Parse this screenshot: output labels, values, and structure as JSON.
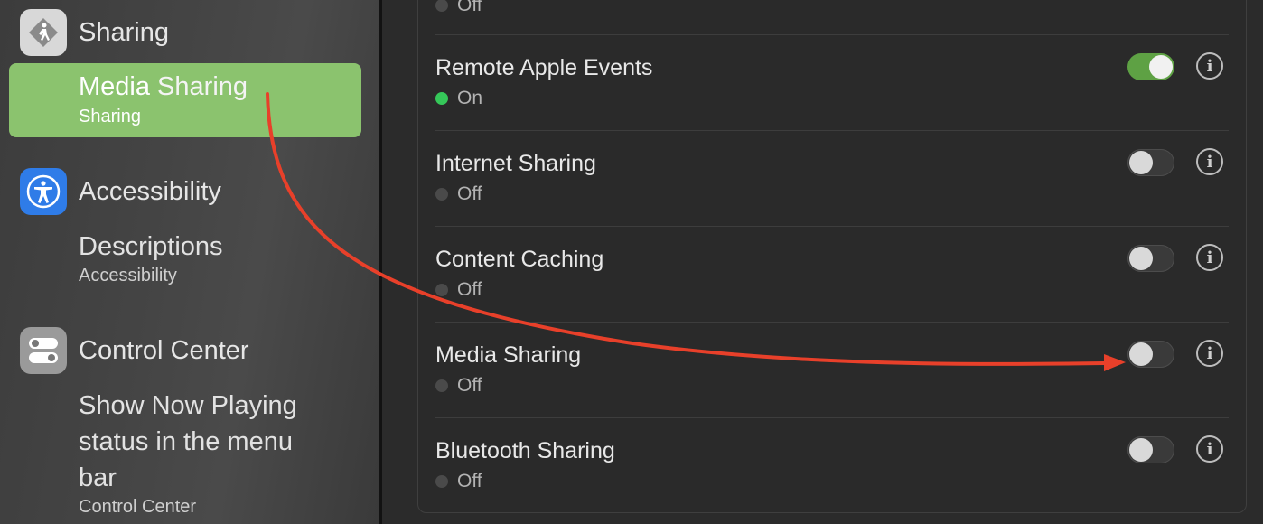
{
  "sidebar": {
    "sharing_category": "Sharing",
    "media_sharing_title_bold": "Media",
    "media_sharing_title_rest": " Sharing",
    "media_sharing_sub": "Sharing",
    "accessibility_category": "Accessibility",
    "descriptions_title": "Descriptions",
    "descriptions_sub": "Accessibility",
    "control_center_category": "Control Center",
    "now_playing_line1": "Show Now Playing",
    "now_playing_line2": "status in the menu",
    "now_playing_line3": "bar",
    "now_playing_sub": "Control Center"
  },
  "main": {
    "top_status": "Off",
    "rows": [
      {
        "title": "Remote Apple Events",
        "status": "On",
        "on": true
      },
      {
        "title": "Internet Sharing",
        "status": "Off",
        "on": false
      },
      {
        "title": "Content Caching",
        "status": "Off",
        "on": false
      },
      {
        "title": "Media Sharing",
        "status": "Off",
        "on": false
      },
      {
        "title": "Bluetooth Sharing",
        "status": "Off",
        "on": false
      }
    ],
    "info_glyph": "i"
  },
  "colors": {
    "highlight": "#8bc36e",
    "toggle_on": "#5ea144",
    "status_on": "#35c759",
    "arrow": "#e8402a"
  }
}
